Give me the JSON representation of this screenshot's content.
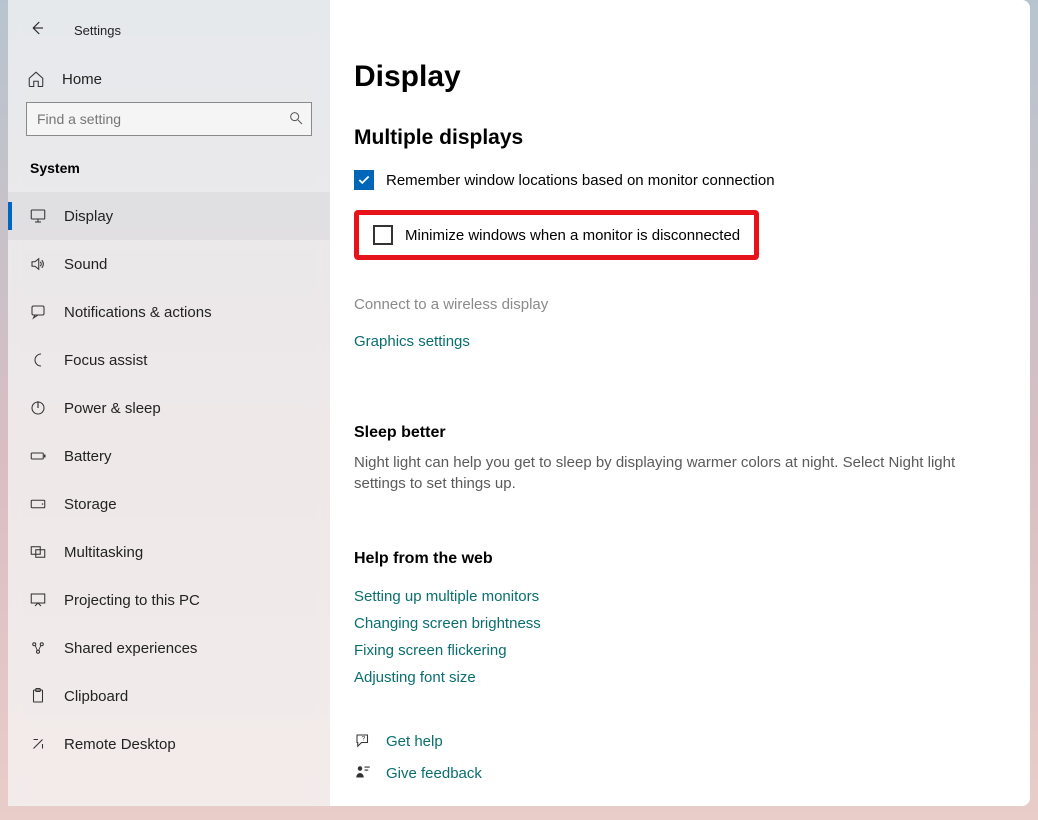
{
  "app_title": "Settings",
  "home_label": "Home",
  "search_placeholder": "Find a setting",
  "category_label": "System",
  "nav_items": [
    {
      "label": "Display",
      "active": true,
      "icon": "display"
    },
    {
      "label": "Sound",
      "active": false,
      "icon": "sound"
    },
    {
      "label": "Notifications & actions",
      "active": false,
      "icon": "notifications"
    },
    {
      "label": "Focus assist",
      "active": false,
      "icon": "focus"
    },
    {
      "label": "Power & sleep",
      "active": false,
      "icon": "power"
    },
    {
      "label": "Battery",
      "active": false,
      "icon": "battery"
    },
    {
      "label": "Storage",
      "active": false,
      "icon": "storage"
    },
    {
      "label": "Multitasking",
      "active": false,
      "icon": "multitasking"
    },
    {
      "label": "Projecting to this PC",
      "active": false,
      "icon": "projecting"
    },
    {
      "label": "Shared experiences",
      "active": false,
      "icon": "shared"
    },
    {
      "label": "Clipboard",
      "active": false,
      "icon": "clipboard"
    },
    {
      "label": "Remote Desktop",
      "active": false,
      "icon": "remote"
    }
  ],
  "page": {
    "title": "Display",
    "multiple_displays": {
      "heading": "Multiple displays",
      "remember_label": "Remember window locations based on monitor connection",
      "remember_checked": true,
      "minimize_label": "Minimize windows when a monitor is disconnected",
      "minimize_checked": false,
      "wireless_link": "Connect to a wireless display",
      "graphics_link": "Graphics settings"
    },
    "sleep_better": {
      "heading": "Sleep better",
      "desc": "Night light can help you get to sleep by displaying warmer colors at night. Select Night light settings to set things up."
    },
    "help_web": {
      "heading": "Help from the web",
      "links": [
        "Setting up multiple monitors",
        "Changing screen brightness",
        "Fixing screen flickering",
        "Adjusting font size"
      ]
    },
    "footer": {
      "get_help": "Get help",
      "give_feedback": "Give feedback"
    }
  }
}
